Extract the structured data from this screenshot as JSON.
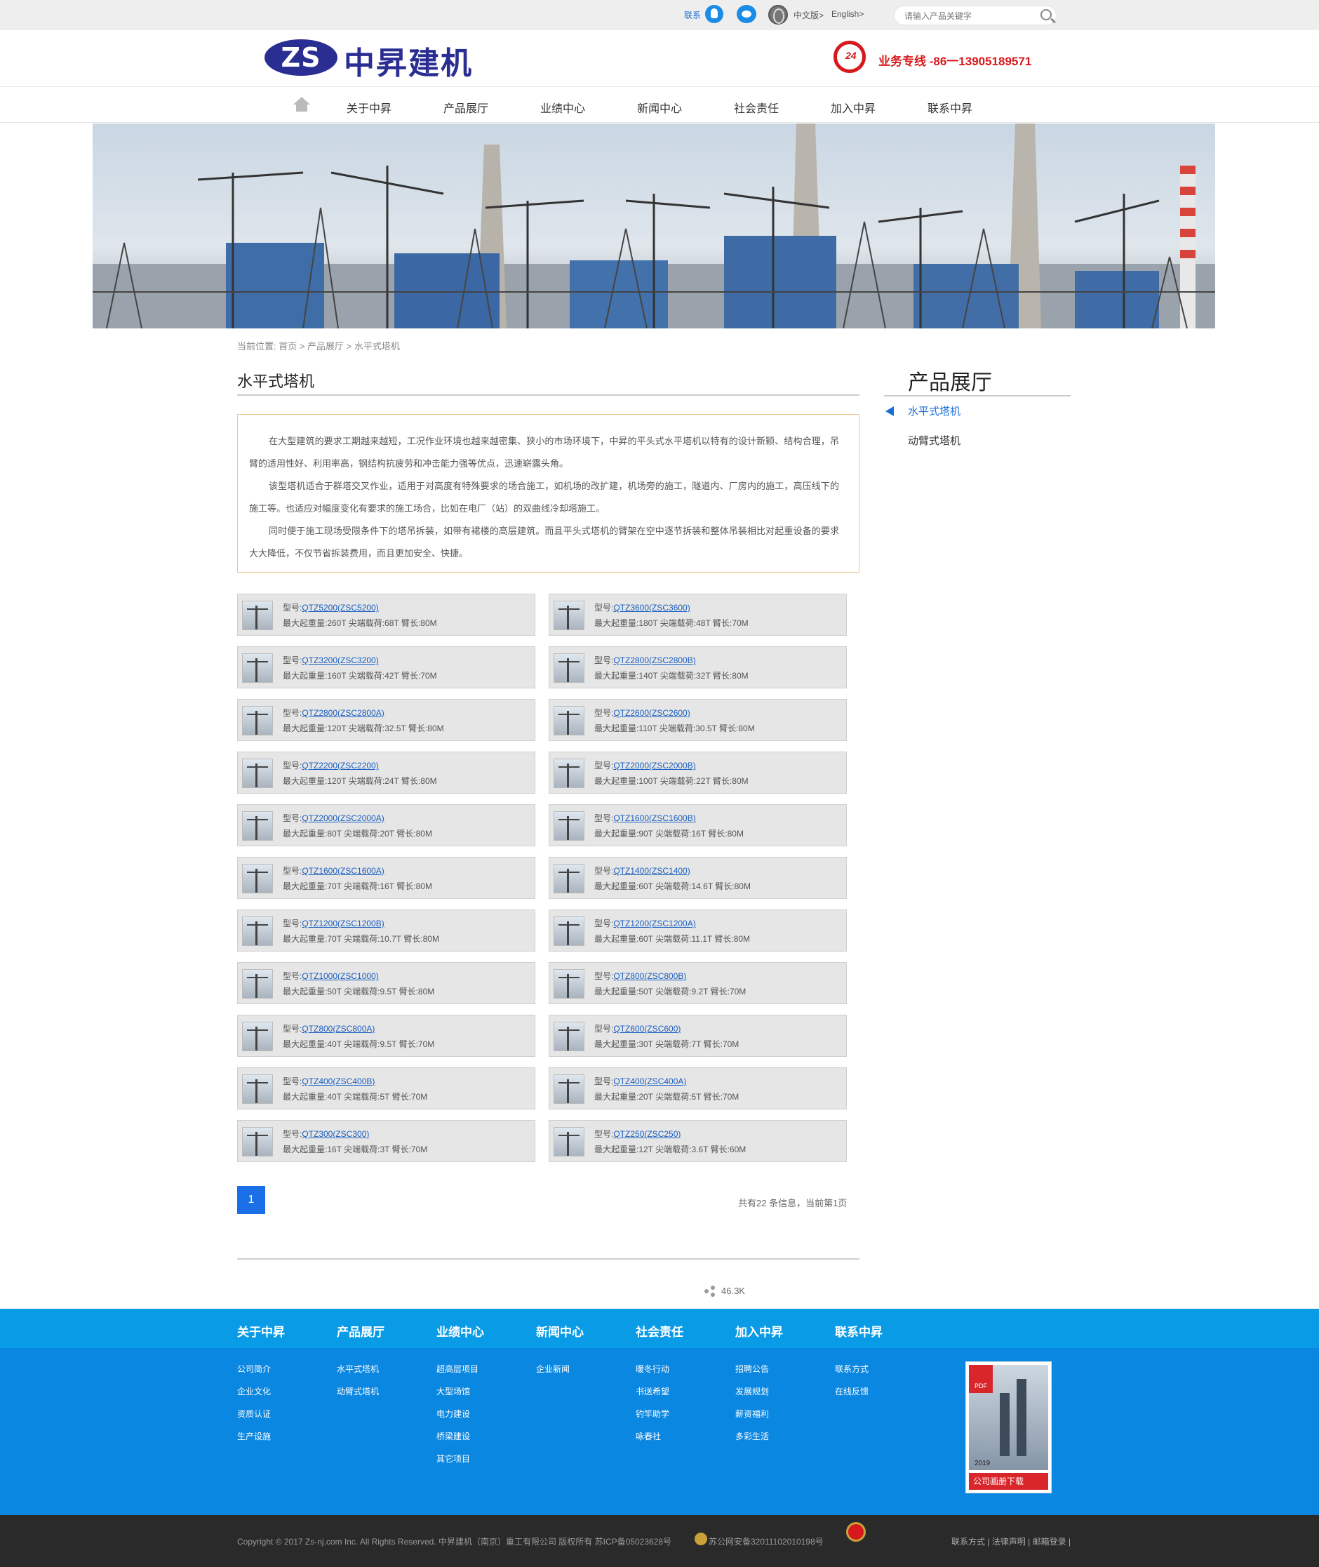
{
  "topbar": {
    "contact_label": "联系",
    "chinese_label": "中文版>",
    "english_label": "English>",
    "search_placeholder": "请输入产品关键字"
  },
  "header": {
    "logo_letters": "ZS",
    "company_name": "中昇建机",
    "hotline_label": "业务专线 -86一13905189571"
  },
  "nav": {
    "items": [
      "关于中昇",
      "产品展厅",
      "业绩中心",
      "新闻中心",
      "社会责任",
      "加入中昇",
      "联系中昇"
    ]
  },
  "breadcrumb": "当前位置: 首页 > 产品展厅 > 水平式塔机",
  "main": {
    "title": "水平式塔机",
    "intro": [
      "在大型建筑的要求工期越来越短，工况作业环境也越来越密集、狭小的市场环境下，中昇的平头式水平塔机以特有的设计新颖、结构合理，吊臂的适用性好、利用率高，钢结构抗疲劳和冲击能力强等优点，迅速崭露头角。",
      "该型塔机适合于群塔交叉作业，适用于对高度有特殊要求的场合施工，如机场的改扩建，机场旁的施工，隧道内、厂房内的施工，高压线下的施工等。也适应对幅度变化有要求的施工场合，比如在电厂（站）的双曲线冷却塔施工。",
      "同时便于施工现场受限条件下的塔吊拆装，如带有裙楼的高层建筑。而且平头式塔机的臂架在空中逐节拆装和整体吊装相比对起重设备的要求大大降低，不仅节省拆装费用，而且更加安全、快捷。"
    ],
    "model_prefix": "型号:",
    "products": [
      {
        "model": "QTZ5200(ZSC5200)",
        "spec": "最大起重量:260T 尖端载荷:68T 臂长:80M"
      },
      {
        "model": "QTZ3600(ZSC3600)",
        "spec": "最大起重量:180T 尖端载荷:48T 臂长:70M"
      },
      {
        "model": "QTZ3200(ZSC3200)",
        "spec": "最大起重量:160T 尖端载荷:42T 臂长:70M"
      },
      {
        "model": "QTZ2800(ZSC2800B)",
        "spec": "最大起重量:140T 尖端载荷:32T 臂长:80M"
      },
      {
        "model": "QTZ2800(ZSC2800A)",
        "spec": "最大起重量:120T 尖端载荷:32.5T 臂长:80M"
      },
      {
        "model": "QTZ2600(ZSC2600)",
        "spec": "最大起重量:110T 尖端载荷:30.5T 臂长:80M"
      },
      {
        "model": "QTZ2200(ZSC2200)",
        "spec": "最大起重量:120T 尖端载荷:24T 臂长:80M"
      },
      {
        "model": "QTZ2000(ZSC2000B)",
        "spec": "最大起重量:100T 尖端载荷:22T 臂长:80M"
      },
      {
        "model": "QTZ2000(ZSC2000A)",
        "spec": "最大起重量:80T 尖端载荷:20T 臂长:80M"
      },
      {
        "model": "QTZ1600(ZSC1600B)",
        "spec": "最大起重量:90T 尖端载荷:16T 臂长:80M"
      },
      {
        "model": "QTZ1600(ZSC1600A)",
        "spec": "最大起重量:70T 尖端载荷:16T 臂长:80M"
      },
      {
        "model": "QTZ1400(ZSC1400)",
        "spec": "最大起重量:60T 尖端载荷:14.6T 臂长:80M"
      },
      {
        "model": "QTZ1200(ZSC1200B)",
        "spec": "最大起重量:70T 尖端载荷:10.7T 臂长:80M"
      },
      {
        "model": "QTZ1200(ZSC1200A)",
        "spec": "最大起重量:60T 尖端载荷:11.1T 臂长:80M"
      },
      {
        "model": "QTZ1000(ZSC1000)",
        "spec": "最大起重量:50T 尖端载荷:9.5T 臂长:80M"
      },
      {
        "model": "QTZ800(ZSC800B)",
        "spec": "最大起重量:50T 尖端载荷:9.2T 臂长:70M"
      },
      {
        "model": "QTZ800(ZSC800A)",
        "spec": "最大起重量:40T 尖端载荷:9.5T 臂长:70M"
      },
      {
        "model": "QTZ600(ZSC600)",
        "spec": "最大起重量:30T 尖端载荷:7T 臂长:70M"
      },
      {
        "model": "QTZ400(ZSC400B)",
        "spec": "最大起重量:40T 尖端载荷:5T 臂长:70M"
      },
      {
        "model": "QTZ400(ZSC400A)",
        "spec": "最大起重量:20T 尖端载荷:5T 臂长:70M"
      },
      {
        "model": "QTZ300(ZSC300)",
        "spec": "最大起重量:16T 尖端载荷:3T 臂长:70M"
      },
      {
        "model": "QTZ250(ZSC250)",
        "spec": "最大起重量:12T 尖端载荷:3.6T 臂长:60M"
      }
    ],
    "pagination": {
      "current": "1",
      "info": "共有22 条信息，当前第1页"
    },
    "share_count": "46.3K"
  },
  "sidebar": {
    "title": "产品展厅",
    "items": [
      {
        "label": "水平式塔机",
        "active": true
      },
      {
        "label": "动臂式塔机",
        "active": false
      }
    ]
  },
  "footer": {
    "columns": [
      {
        "title": "关于中昇",
        "links": [
          "公司简介",
          "企业文化",
          "资质认证",
          "生产设施"
        ]
      },
      {
        "title": "产品展厅",
        "links": [
          "水平式塔机",
          "动臂式塔机"
        ]
      },
      {
        "title": "业绩中心",
        "links": [
          "超高层项目",
          "大型场馆",
          "电力建设",
          "桥梁建设",
          "其它项目"
        ]
      },
      {
        "title": "新闻中心",
        "links": [
          "企业新闻"
        ]
      },
      {
        "title": "社会责任",
        "links": [
          "暖冬行动",
          "书送希望",
          "钓竿助学",
          "咏春社"
        ]
      },
      {
        "title": "加入中昇",
        "links": [
          "招聘公告",
          "发展规划",
          "薪资福利",
          "多彩生活"
        ]
      },
      {
        "title": "联系中昇",
        "links": [
          "联系方式",
          "在线反馈"
        ]
      }
    ],
    "brochure": {
      "pdf_label": "PDF",
      "year": "2019",
      "download_label": "公司画册下载"
    },
    "copyright": "Copyright © 2017 Zs-nj.com Inc. All Rights Reserved. 中昇建机（南京）重工有限公司 版权所有    苏ICP备05023628号",
    "police_record": "苏公网安备32011102010198号",
    "bottom_links": "联系方式 | 法律声明 | 邮箱登录 |",
    "colors": {
      "primary": "#1a6fe6",
      "footer_top": "#0a9be6",
      "footer_mid": "#0a87e1",
      "footer_bottom": "#2a2a2a",
      "accent_red": "#d7191d",
      "brand_navy": "#2a2d92"
    }
  }
}
